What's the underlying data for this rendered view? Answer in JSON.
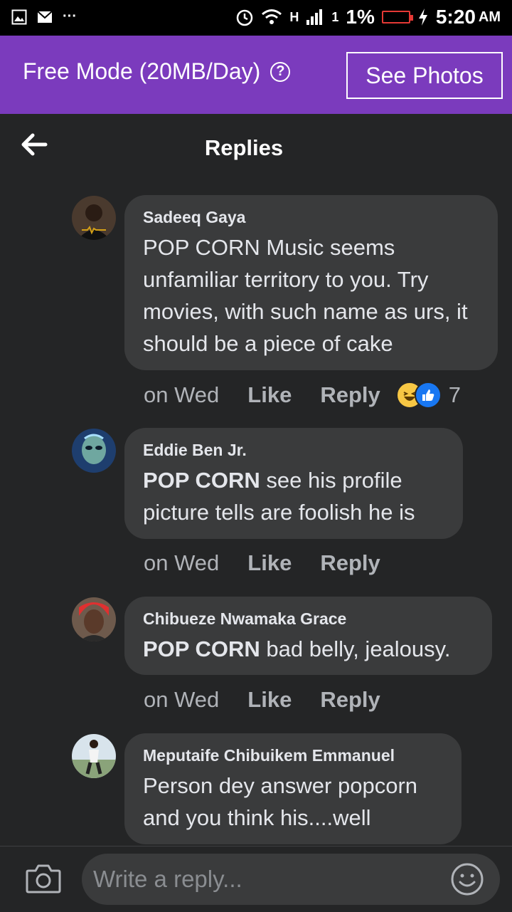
{
  "status_bar": {
    "battery": "1%",
    "time": "5:20",
    "ampm": "AM",
    "network": "H",
    "sim": "1"
  },
  "free_mode": {
    "label": "Free Mode (20MB/Day)",
    "button": "See Photos"
  },
  "header": {
    "title": "Replies"
  },
  "comments": [
    {
      "author": "Sadeeq Gaya",
      "mention": "",
      "text": "POP CORN Music seems unfamiliar territory to you. Try movies, with such name as urs, it should be a piece of cake",
      "time": "on Wed",
      "like": "Like",
      "reply": "Reply",
      "reaction_count": "7"
    },
    {
      "author": "Eddie Ben Jr.",
      "mention": "POP CORN",
      "text": " see his profile picture tells are foolish he is",
      "time": "on Wed",
      "like": "Like",
      "reply": "Reply"
    },
    {
      "author": "Chibueze Nwamaka Grace",
      "mention": "POP CORN",
      "text": " bad belly, jealousy.",
      "time": "on Wed",
      "like": "Like",
      "reply": "Reply"
    },
    {
      "author": "Meputaife Chibuikem Emmanuel",
      "mention": "",
      "text": "Person dey answer popcorn and you think his....well"
    }
  ],
  "composer": {
    "placeholder": "Write a reply..."
  },
  "colors": {
    "background": "#242526",
    "bubble": "#3a3b3c",
    "free_mode_bar": "#7b3bbd",
    "like_blue": "#1877f2",
    "haha_yellow": "#f7c744"
  }
}
